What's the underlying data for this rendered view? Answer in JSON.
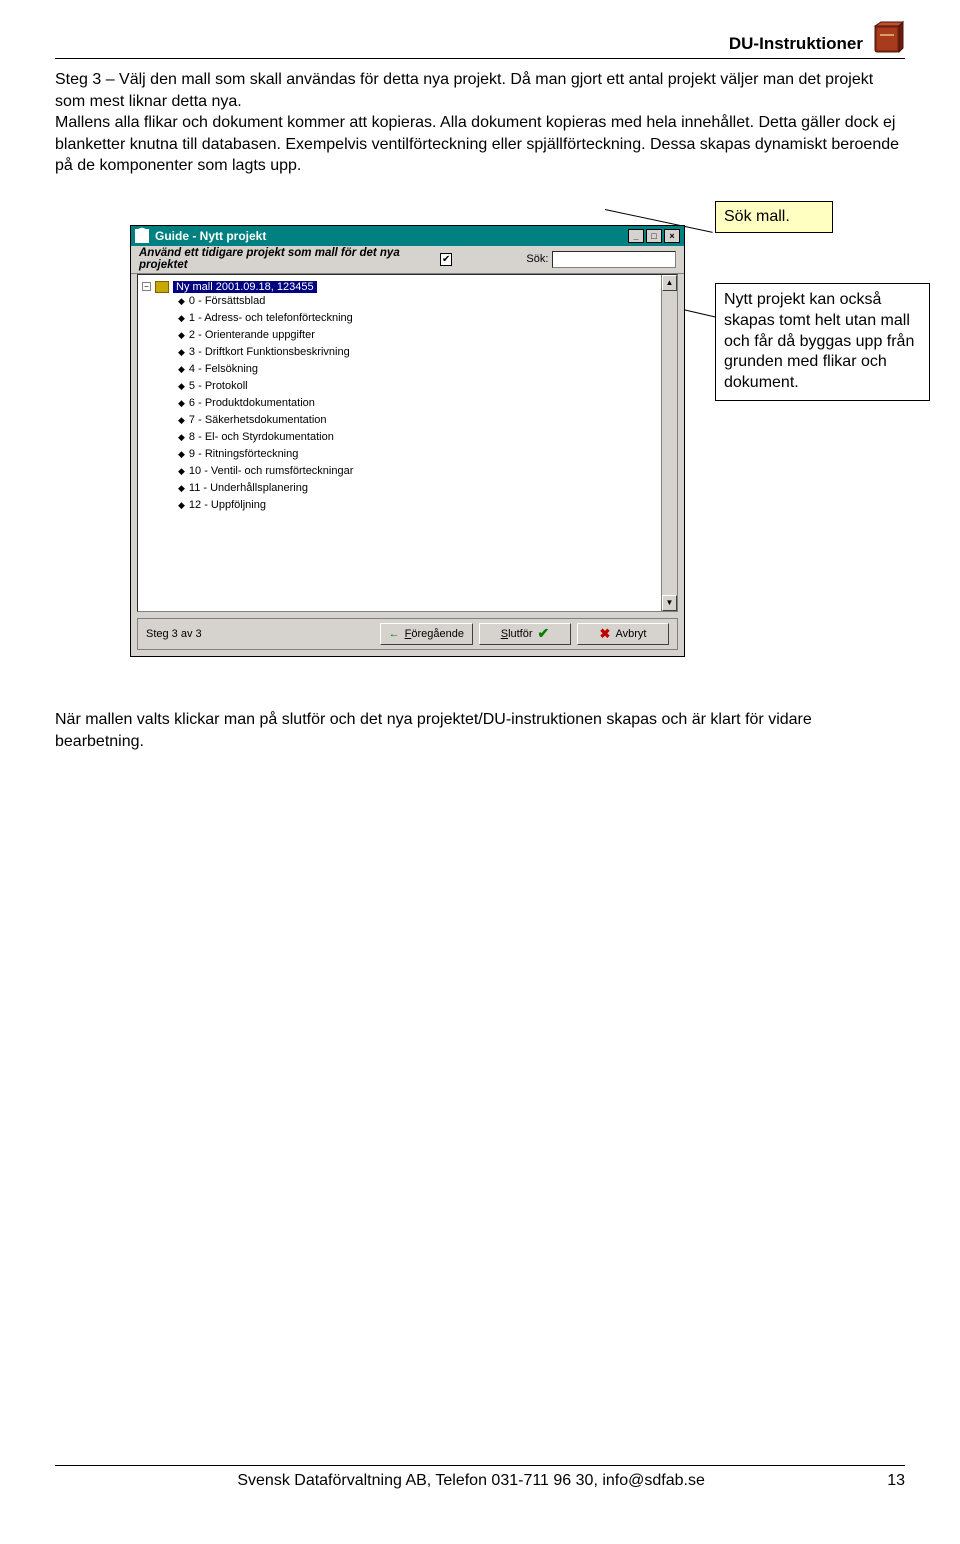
{
  "header": {
    "title": "DU-Instruktioner"
  },
  "para1": "Steg 3 – Välj den mall som skall användas för detta nya projekt. Då man gjort ett antal projekt väljer man det projekt som mest liknar detta nya.",
  "para2": "Mallens alla flikar och dokument kommer att kopieras. Alla dokument kopieras med hela innehållet. Detta gäller dock ej blanketter knutna till databasen. Exempelvis ventilförteckning eller spjällförteckning. Dessa skapas dynamiskt beroende på de komponenter som lagts upp.",
  "window": {
    "title": "Guide - Nytt projekt",
    "subbar_label": "Använd ett tidigare projekt som mall för det nya projektet",
    "check": "✔",
    "sok_label": "Sök:",
    "tree": {
      "root": "Ny mall 2001.09.18, 123455",
      "items": [
        "0 - Försättsblad",
        "1 - Adress- och telefonförteckning",
        "2 - Orienterande uppgifter",
        "3 - Driftkort Funktionsbeskrivning",
        "4 - Felsökning",
        "5 - Protokoll",
        "6 - Produktdokumentation",
        "7 - Säkerhetsdokumentation",
        "8 - El- och Styrdokumentation",
        "9 - Ritningsförteckning",
        "10 - Ventil- och rumsförteckningar",
        "11 - Underhållsplanering",
        "12 - Uppföljning"
      ]
    },
    "step": "Steg 3 av 3",
    "btn_prev_arrow": "←",
    "btn_prev": "Föregående",
    "btn_finish": "Slutför",
    "btn_cancel": "Avbryt"
  },
  "callout1": "Sök mall.",
  "callout2": "Nytt projekt kan också skapas tomt helt utan mall och får då byggas upp från grunden med flikar och dokument.",
  "para3": "När mallen valts klickar man på slutför och det nya projektet/DU-instruktionen skapas och är klart för vidare bearbetning.",
  "footer": {
    "center": "Svensk Dataförvaltning AB, Telefon 031-711 96 30, info@sdfab.se",
    "page": "13"
  }
}
